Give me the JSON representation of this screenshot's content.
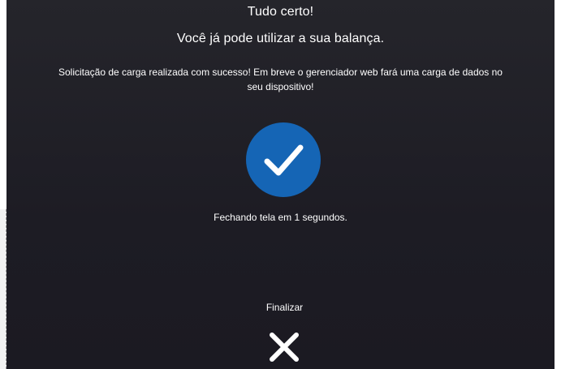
{
  "header": {
    "title": "Tudo certo!",
    "subtitle": "Você já pode utilizar a sua balança."
  },
  "message": "Solicitação de carga realizada com sucesso! Em breve o gerenciador web fará uma carga de dados no seu dispositivo!",
  "status": {
    "countdown": "Fechando tela em 1 segundos."
  },
  "actions": {
    "finish_label": "Finalizar"
  },
  "icons": {
    "success": "checkmark-icon",
    "close": "close-icon"
  },
  "colors": {
    "background": "#1e1d25",
    "success_circle": "#1565b5",
    "text": "#ffffff"
  }
}
